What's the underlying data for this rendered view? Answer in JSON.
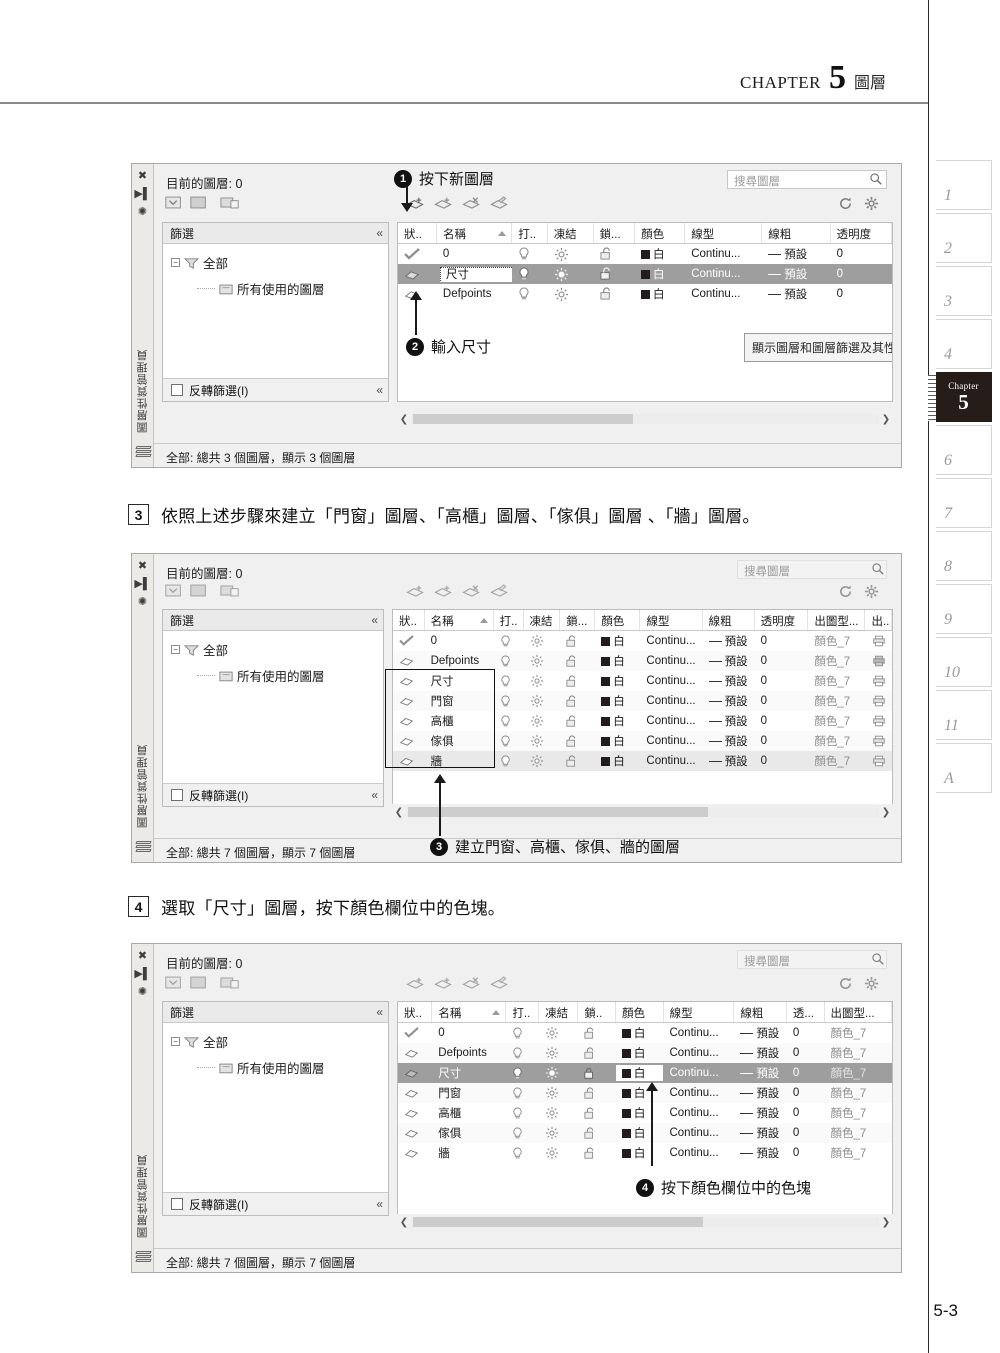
{
  "header": {
    "chapter_word": "CHAPTER",
    "chapter_number": "5",
    "chapter_label": "圖層"
  },
  "page_number": "5-3",
  "side_tabs": [
    {
      "label": "1",
      "active": false
    },
    {
      "label": "2",
      "active": false
    },
    {
      "label": "3",
      "active": false
    },
    {
      "label": "4",
      "active": false
    },
    {
      "label": "5",
      "active": true,
      "word": "Chapter"
    },
    {
      "label": "6",
      "active": false
    },
    {
      "label": "7",
      "active": false
    },
    {
      "label": "8",
      "active": false
    },
    {
      "label": "9",
      "active": false
    },
    {
      "label": "10",
      "active": false
    },
    {
      "label": "11",
      "active": false
    },
    {
      "label": "A",
      "active": false
    }
  ],
  "steps": {
    "step3": {
      "num": "3",
      "text": "依照上述步驟來建立「門窗」圖層、「高櫃」圖層、「傢俱」圖層 、「牆」圖層。"
    },
    "step4": {
      "num": "4",
      "text": "選取「尺寸」圖層，按下顏色欄位中的色塊。"
    }
  },
  "palette1": {
    "vertical_title": "圖層性質管理員",
    "current_layer": "目前的圖層: 0",
    "search_placeholder": "搜尋圖層",
    "filter_title": "篩選",
    "tree": [
      {
        "label": "全部",
        "level": 0
      },
      {
        "label": "所有使用的圖層",
        "level": 1
      }
    ],
    "invert_filter": "反轉篩選(I)",
    "status": "全部: 總共 3 個圖層，顯示 3 個圖層",
    "columns": [
      "狀..",
      "名稱",
      "打..",
      "凍結",
      "鎖...",
      "顏色",
      "線型",
      "線粗",
      "透明度"
    ],
    "rows": [
      {
        "name": "0",
        "color": "白",
        "linetype": "Continu...",
        "lineweight": "預設",
        "transparency": "0",
        "selected": false,
        "current": true
      },
      {
        "name": "尺寸",
        "color": "白",
        "linetype": "Continu...",
        "lineweight": "預設",
        "transparency": "0",
        "selected": true,
        "current": false,
        "editing": true
      },
      {
        "name": "Defpoints",
        "color": "白",
        "linetype": "Continu...",
        "lineweight": "預設",
        "transparency": "0",
        "selected": false,
        "current": false
      }
    ],
    "tooltip": "顯示圖層和圖層篩選及其性",
    "callout1": {
      "num": "1",
      "text": "按下新圖層"
    },
    "callout2": {
      "num": "2",
      "text": "輸入尺寸"
    }
  },
  "palette2": {
    "vertical_title": "圖層性質管理員",
    "current_layer": "目前的圖層: 0",
    "search_placeholder": "搜尋圖層",
    "filter_title": "篩選",
    "tree": [
      {
        "label": "全部",
        "level": 0
      },
      {
        "label": "所有使用的圖層",
        "level": 1
      }
    ],
    "invert_filter": "反轉篩選(I)",
    "status": "全部: 總共 7 個圖層，顯示 7 個圖層",
    "columns": [
      "狀..",
      "名稱",
      "打..",
      "凍結",
      "鎖...",
      "顏色",
      "線型",
      "線粗",
      "透明度",
      "出圖型...",
      "出.."
    ],
    "rows": [
      {
        "name": "0",
        "color": "白",
        "linetype": "Continu...",
        "lineweight": "預設",
        "transparency": "0",
        "plotstyle": "顏色_7",
        "current": true
      },
      {
        "name": "Defpoints",
        "color": "白",
        "linetype": "Continu...",
        "lineweight": "預設",
        "transparency": "0",
        "plotstyle": "顏色_7"
      },
      {
        "name": "尺寸",
        "color": "白",
        "linetype": "Continu...",
        "lineweight": "預設",
        "transparency": "0",
        "plotstyle": "顏色_7"
      },
      {
        "name": "門窗",
        "color": "白",
        "linetype": "Continu...",
        "lineweight": "預設",
        "transparency": "0",
        "plotstyle": "顏色_7"
      },
      {
        "name": "高櫃",
        "color": "白",
        "linetype": "Continu...",
        "lineweight": "預設",
        "transparency": "0",
        "plotstyle": "顏色_7"
      },
      {
        "name": "傢俱",
        "color": "白",
        "linetype": "Continu...",
        "lineweight": "預設",
        "transparency": "0",
        "plotstyle": "顏色_7"
      },
      {
        "name": "牆",
        "color": "白",
        "linetype": "Continu...",
        "lineweight": "預設",
        "transparency": "0",
        "plotstyle": "顏色_7"
      }
    ],
    "callout3": {
      "num": "3",
      "text": "建立門窗、高櫃、傢俱、牆的圖層"
    }
  },
  "palette3": {
    "vertical_title": "圖層性質管理員",
    "current_layer": "目前的圖層: 0",
    "search_placeholder": "搜尋圖層",
    "filter_title": "篩選",
    "tree": [
      {
        "label": "全部",
        "level": 0
      },
      {
        "label": "所有使用的圖層",
        "level": 1
      }
    ],
    "invert_filter": "反轉篩選(I)",
    "status": "全部: 總共 7 個圖層，顯示 7 個圖層",
    "columns": [
      "狀..",
      "名稱",
      "打..",
      "凍結",
      "鎖..",
      "顏色",
      "線型",
      "線粗",
      "透...",
      "出圖型..."
    ],
    "rows": [
      {
        "name": "0",
        "color": "白",
        "linetype": "Continu...",
        "lineweight": "預設",
        "transparency": "0",
        "plotstyle": "顏色_7",
        "current": true
      },
      {
        "name": "Defpoints",
        "color": "白",
        "linetype": "Continu...",
        "lineweight": "預設",
        "transparency": "0",
        "plotstyle": "顏色_7"
      },
      {
        "name": "尺寸",
        "color": "白",
        "linetype": "Continu...",
        "lineweight": "預設",
        "transparency": "0",
        "plotstyle": "顏色_7",
        "selected": true
      },
      {
        "name": "門窗",
        "color": "白",
        "linetype": "Continu...",
        "lineweight": "預設",
        "transparency": "0",
        "plotstyle": "顏色_7"
      },
      {
        "name": "高櫃",
        "color": "白",
        "linetype": "Continu...",
        "lineweight": "預設",
        "transparency": "0",
        "plotstyle": "顏色_7"
      },
      {
        "name": "傢俱",
        "color": "白",
        "linetype": "Continu...",
        "lineweight": "預設",
        "transparency": "0",
        "plotstyle": "顏色_7"
      },
      {
        "name": "牆",
        "color": "白",
        "linetype": "Continu...",
        "lineweight": "預設",
        "transparency": "0",
        "plotstyle": "顏色_7"
      }
    ],
    "callout4": {
      "num": "4",
      "text": "按下顏色欄位中的色塊"
    }
  },
  "colors": {
    "accent_dark": "#261d18",
    "selection_gray": "#9e9e9e",
    "swatch_black": "#221d1c",
    "rule_gray": "#8a8a8a"
  }
}
